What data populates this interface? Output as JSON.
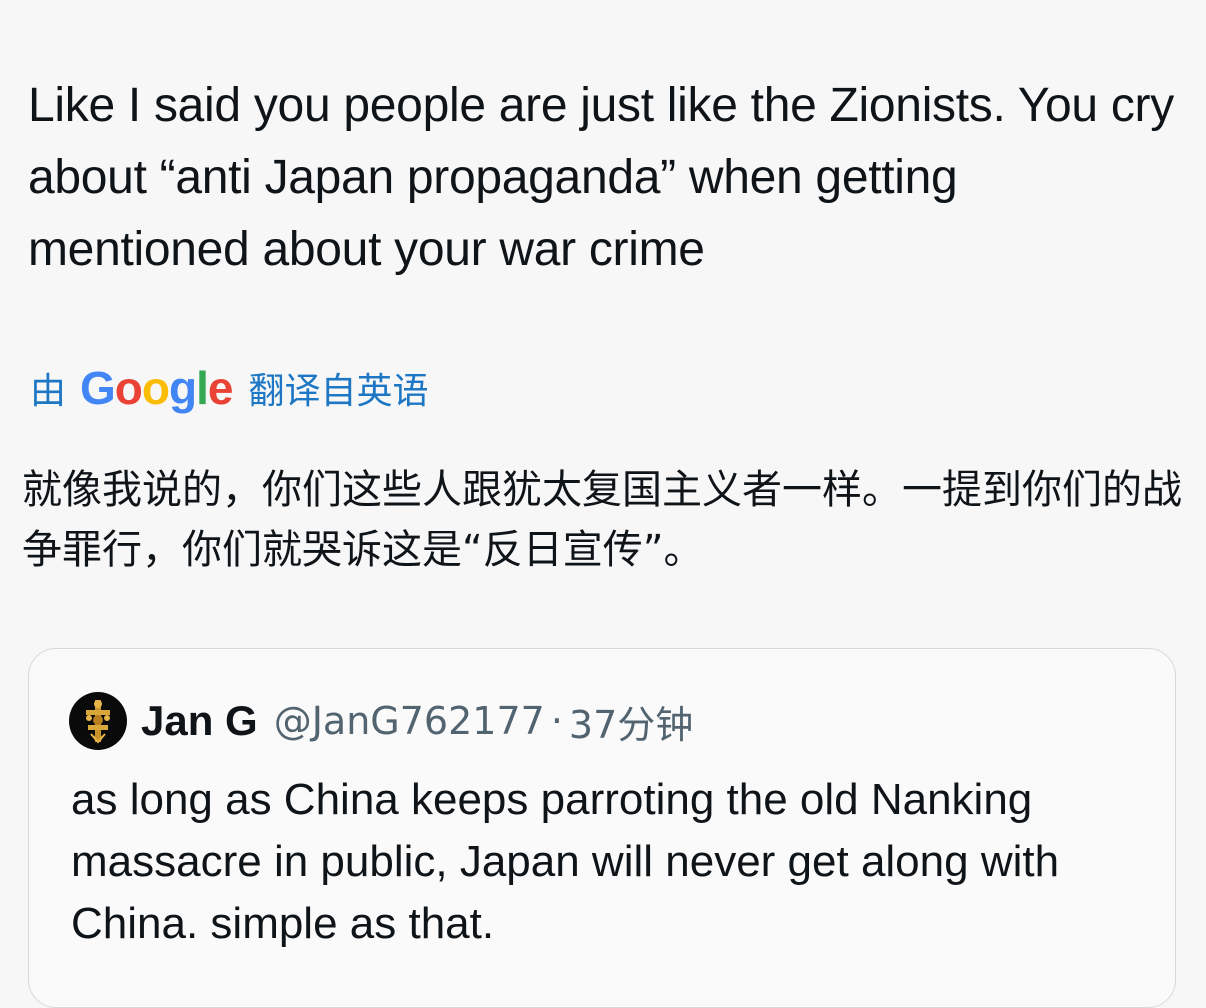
{
  "tweet": {
    "text": "Like I said you people are just like the Zionists. You cry about “anti Japan propaganda” when getting mentioned about your war crime"
  },
  "translation": {
    "by_label": "由",
    "provider": "Google",
    "suffix": "翻译自英语",
    "translated_text": "就像我说的，你们这些人跟犹太复国主义者一样。一提到你们的战争罪行，你们就哭诉这是“反日宣传”。"
  },
  "quoted_tweet": {
    "display_name": "Jan G",
    "handle": "@JanG762177",
    "separator": "·",
    "time_ago": "37分钟",
    "text": "as long as China keeps parroting the old Nanking massacre in public, Japan will never get along with China. simple as that.",
    "avatar_icon": "ornate-gold-emblem-icon"
  },
  "colors": {
    "translation_label": "#1d77c4",
    "google_blue": "#4285f4",
    "google_red": "#ea4335",
    "google_yellow": "#fbbc05",
    "google_green": "#34a853"
  }
}
